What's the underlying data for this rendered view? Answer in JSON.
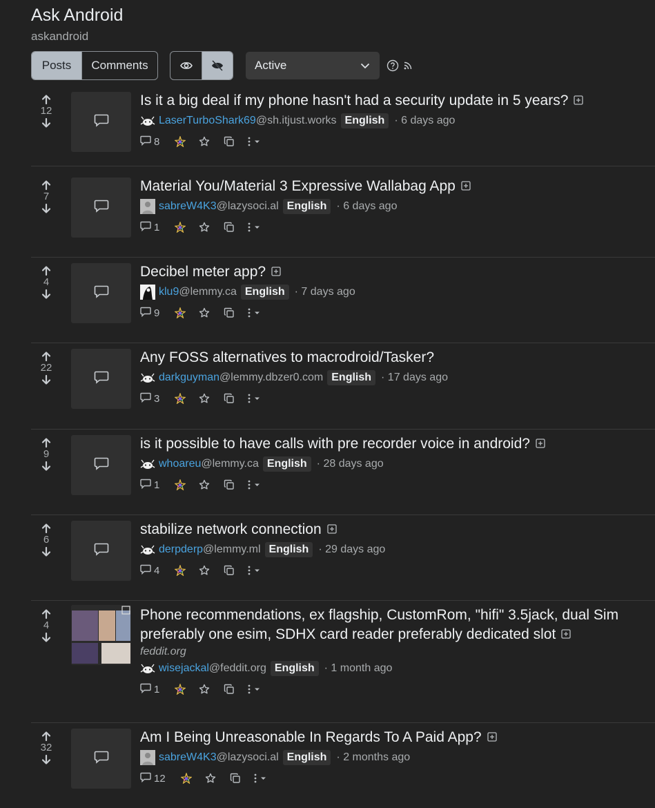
{
  "community": {
    "title": "Ask Android",
    "name": "askandroid"
  },
  "toolbar": {
    "tabs": [
      "Posts",
      "Comments"
    ],
    "active_tab": "Posts",
    "sort": "Active",
    "icons": [
      "eye-icon",
      "eye-slash-icon",
      "help-icon",
      "rss-icon"
    ]
  },
  "posts": [
    {
      "votes": "12",
      "title": "Is it a big deal if my phone hasn't had a security update in 5 years?",
      "user": "LaserTurboShark69",
      "instance": "@sh.itjust.works",
      "language": "English",
      "time": "· 6 days ago",
      "comments": "8"
    },
    {
      "votes": "7",
      "title": "Material You/Material 3 Expressive Wallabag App",
      "user": "sabreW4K3",
      "instance": "@lazysoci.al",
      "language": "English",
      "time": "· 6 days ago",
      "comments": "1"
    },
    {
      "votes": "4",
      "title": "Decibel meter app?",
      "user": "klu9",
      "instance": "@lemmy.ca",
      "language": "English",
      "time": "· 7 days ago",
      "comments": "9"
    },
    {
      "votes": "22",
      "title": "Any FOSS alternatives to macrodroid/Tasker?",
      "user": "darkguyman",
      "instance": "@lemmy.dbzer0.com",
      "language": "English",
      "time": "· 17 days ago",
      "comments": "3"
    },
    {
      "votes": "9",
      "title": "is it possible to have calls with pre recorder voice in android?",
      "user": "whoareu",
      "instance": "@lemmy.ca",
      "language": "English",
      "time": "· 28 days ago",
      "comments": "1"
    },
    {
      "votes": "6",
      "title": "stabilize network connection",
      "user": "derpderp",
      "instance": "@lemmy.ml",
      "language": "English",
      "time": "· 29 days ago",
      "comments": "4"
    },
    {
      "votes": "4",
      "title": "Phone recommendations, ex flagship, CustomRom, \"hifi\" 3.5jack, dual Sim preferably one esim, SDHX card reader preferably dedicated slot",
      "domain": "feddit.org",
      "user": "wisejackal",
      "instance": "@feddit.org",
      "language": "English",
      "time": "· 1 month ago",
      "comments": "1"
    },
    {
      "votes": "32",
      "title": "Am I Being Unreasonable In Regards To A Paid App?",
      "user": "sabreW4K3",
      "instance": "@lazysoci.al",
      "language": "English",
      "time": "· 2 months ago",
      "comments": "12"
    }
  ],
  "colors": {
    "background": "#222222",
    "link": "#4aa3df",
    "active_tab": "#b4bcc4"
  }
}
